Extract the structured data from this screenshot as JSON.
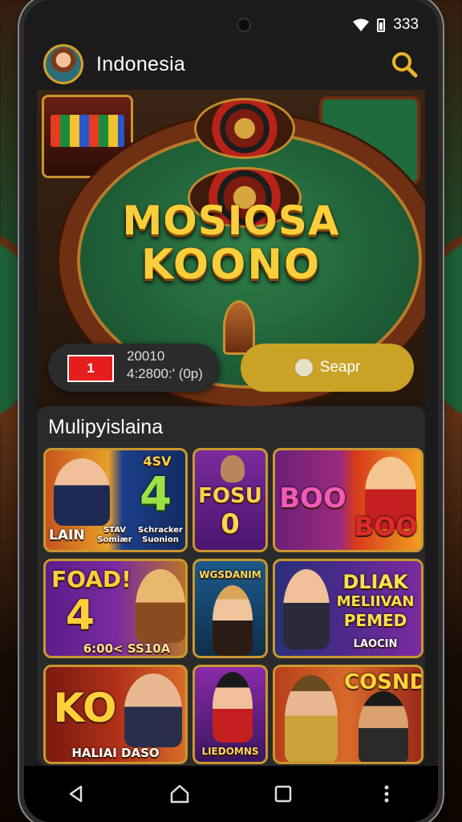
{
  "status_bar": {
    "signal_text": "333"
  },
  "header": {
    "title": "Indonesia"
  },
  "hero": {
    "logo_line1": "MOSIOSA",
    "logo_line2": "KOONO"
  },
  "stats": {
    "badge": "1",
    "line1": "20010",
    "line2": "4:2800:' (0p)"
  },
  "search_button": {
    "label": "Seapr"
  },
  "section": {
    "title": "Mulipyislaina"
  },
  "games": [
    {
      "title": "4",
      "sub1": "LAIN",
      "sub2": "STAV Somiær",
      "sub3": "Schracker Suonion",
      "badge": "4SV"
    },
    {
      "title": "FOSU",
      "sub1": "0"
    },
    {
      "title": "BOO",
      "sub1": "BOO"
    },
    {
      "title": "FOAD!",
      "sub1": "4",
      "sub2": "6:00< SS10A"
    },
    {
      "title": "WGSDANIM"
    },
    {
      "title": "DLIAK",
      "sub1": "MELIIVAN",
      "sub2": "PEMED",
      "sub3": "LAOCIN"
    },
    {
      "title": "KO",
      "sub1": "HALIAI DASO"
    },
    {
      "title": "LIEDOMNS"
    },
    {
      "title": "COSND"
    }
  ]
}
